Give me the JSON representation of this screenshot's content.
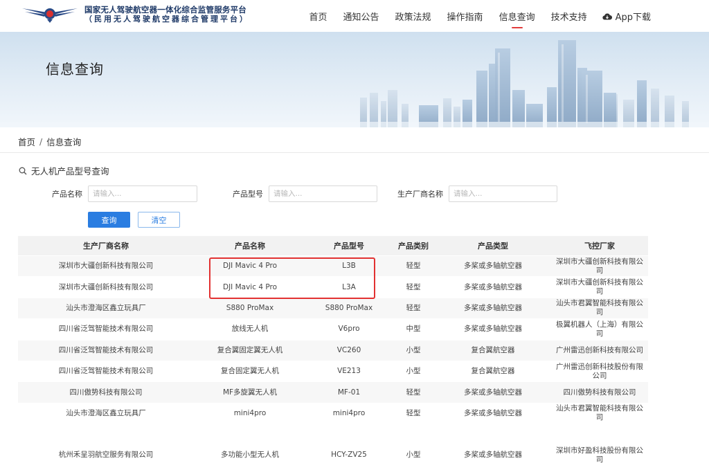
{
  "header": {
    "brand_line1": "国家无人驾驶航空器一体化综合监管服务平台",
    "brand_line2": "（民用无人驾驶航空器综合管理平台）",
    "nav": [
      {
        "label": "首页",
        "active": false
      },
      {
        "label": "通知公告",
        "active": false
      },
      {
        "label": "政策法规",
        "active": false
      },
      {
        "label": "操作指南",
        "active": false
      },
      {
        "label": "信息查询",
        "active": true
      },
      {
        "label": "技术支持",
        "active": false
      }
    ],
    "app_download": "App下载",
    "app_icon": "cloud-download-icon"
  },
  "banner": {
    "title": "信息查询"
  },
  "breadcrumb": {
    "home": "首页",
    "sep": "/",
    "current": "信息查询"
  },
  "search": {
    "title": "无人机产品型号查询",
    "icon": "search-icon",
    "fields": [
      {
        "label": "产品名称",
        "placeholder": "请输入..."
      },
      {
        "label": "产品型号",
        "placeholder": "请输入..."
      },
      {
        "label": "生产厂商名称",
        "placeholder": "请输入..."
      }
    ],
    "query_label": "查询",
    "clear_label": "清空"
  },
  "table": {
    "columns": [
      "生产厂商名称",
      "产品名称",
      "产品型号",
      "产品类别",
      "产品类型",
      "飞控厂家"
    ],
    "rows": [
      [
        "深圳市大疆创新科技有限公司",
        "DJI Mavic 4 Pro",
        "L3B",
        "轻型",
        "多桨或多轴航空器",
        "深圳市大疆创新科技有限公司"
      ],
      [
        "深圳市大疆创新科技有限公司",
        "DJI Mavic 4 Pro",
        "L3A",
        "轻型",
        "多桨或多轴航空器",
        "深圳市大疆创新科技有限公司"
      ],
      [
        "汕头市澄海区鑫立玩具厂",
        "S880 ProMax",
        "S880 ProMax",
        "轻型",
        "多桨或多轴航空器",
        "汕头市君翼智能科技有限公司"
      ],
      [
        "四川省泛驾智能技术有限公司",
        "放线无人机",
        "V6pro",
        "中型",
        "多桨或多轴航空器",
        "极翼机器人（上海）有限公司"
      ],
      [
        "四川省泛驾智能技术有限公司",
        "复合翼固定翼无人机",
        "VC260",
        "小型",
        "复合翼航空器",
        "广州雷迅创新科技有限公司"
      ],
      [
        "四川省泛驾智能技术有限公司",
        "复合固定翼无人机",
        "VE213",
        "小型",
        "复合翼航空器",
        "广州雷迅创新科技股份有限公司"
      ],
      [
        "四川傲势科技有限公司",
        "MF多旋翼无人机",
        "MF-01",
        "轻型",
        "多桨或多轴航空器",
        "四川傲势科技有限公司"
      ],
      [
        "汕头市澄海区鑫立玩具厂",
        "mini4pro",
        "mini4pro",
        "轻型",
        "多桨或多轴航空器",
        "汕头市君翼智能科技有限公司"
      ]
    ],
    "last_row": [
      "杭州禾呈羽航空服务有限公司",
      "多功能小型无人机",
      "HCY-ZV25",
      "小型",
      "多桨或多轴航空器",
      "深圳市好盈科技股份有限公司"
    ],
    "highlight_color": "#e23131"
  },
  "colors": {
    "accent": "#2a7de1",
    "nav_active": "#e23b3b",
    "brand": "#1f3a68"
  }
}
